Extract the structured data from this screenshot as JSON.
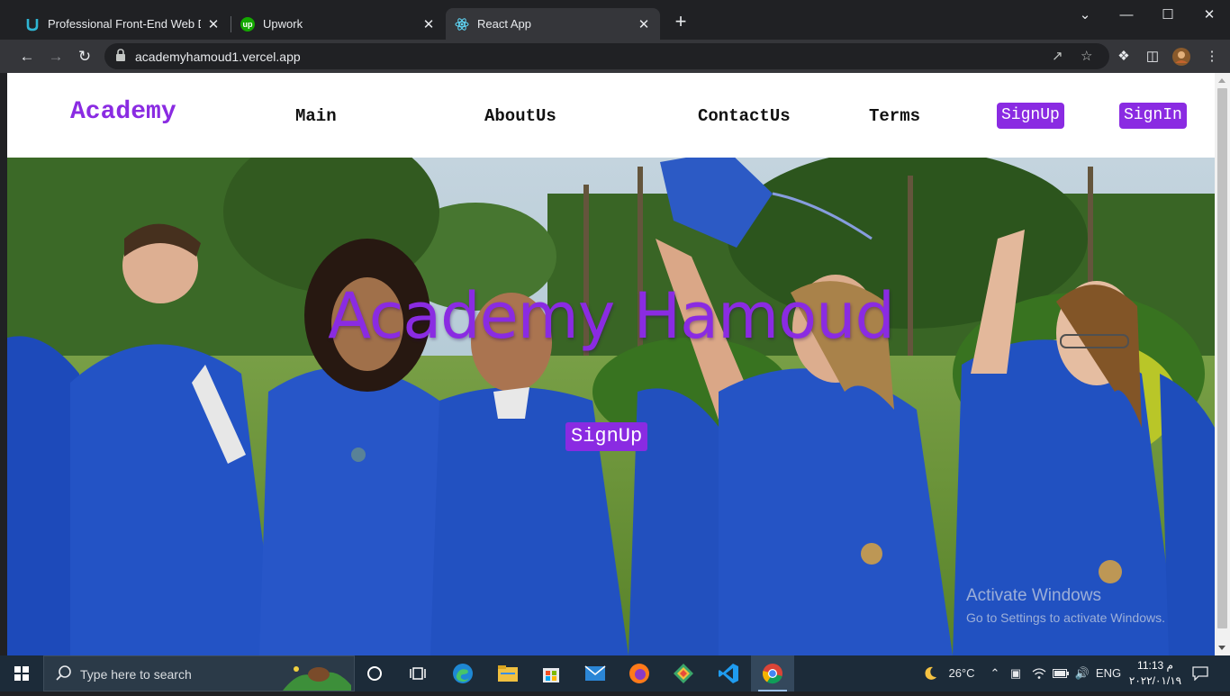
{
  "browser": {
    "tabs": [
      {
        "title": "Professional Front-End Web Devel",
        "close": "✕",
        "favicon": "u-logo-icon"
      },
      {
        "title": "Upwork",
        "close": "✕",
        "favicon": "upwork-icon"
      },
      {
        "title": "React App",
        "close": "✕",
        "favicon": "react-icon",
        "active": true
      }
    ],
    "new_tab": "+",
    "window_controls": {
      "menu": "⌄",
      "minimize": "—",
      "maximize": "☐",
      "close": "✕"
    },
    "url": "academyhamoud1.vercel.app"
  },
  "site": {
    "brand": "Academy",
    "nav": {
      "main": "Main",
      "about": "AboutUs",
      "contact": "ContactUs",
      "terms": "Terms",
      "signup": "SignUp",
      "signin": "SignIn"
    },
    "hero": {
      "title": "Academy Hamoud",
      "cta": "SignUp"
    },
    "accent_color": "#8a2be2"
  },
  "os": {
    "watermark_title": "Activate Windows",
    "watermark_sub": "Go to Settings to activate Windows.",
    "search_placeholder": "Type here to search",
    "weather": "26°C",
    "language": "ENG",
    "time": "11:13 م",
    "date": "٢٠٢٢/٠١/١٩"
  }
}
